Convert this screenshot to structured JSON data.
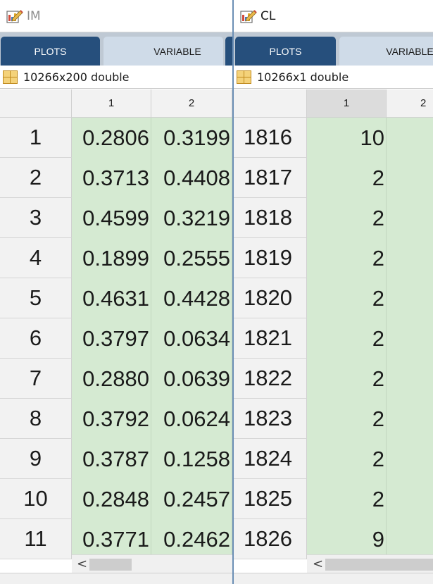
{
  "panes": [
    {
      "title": "IM",
      "icon": "variable-edit-icon",
      "tabs": [
        "PLOTS",
        "VARIABLE"
      ],
      "var_info": "10266x200 double",
      "columns": [
        "1",
        "2"
      ],
      "rows": [
        {
          "index": "1",
          "values": [
            "0.2806",
            "0.3199"
          ]
        },
        {
          "index": "2",
          "values": [
            "0.3713",
            "0.4408"
          ]
        },
        {
          "index": "3",
          "values": [
            "0.4599",
            "0.3219"
          ]
        },
        {
          "index": "4",
          "values": [
            "0.1899",
            "0.2555"
          ]
        },
        {
          "index": "5",
          "values": [
            "0.4631",
            "0.4428"
          ]
        },
        {
          "index": "6",
          "values": [
            "0.3797",
            "0.0634"
          ]
        },
        {
          "index": "7",
          "values": [
            "0.2880",
            "0.0639"
          ]
        },
        {
          "index": "8",
          "values": [
            "0.3792",
            "0.0624"
          ]
        },
        {
          "index": "9",
          "values": [
            "0.3787",
            "0.1258"
          ]
        },
        {
          "index": "10",
          "values": [
            "0.2848",
            "0.2457"
          ]
        },
        {
          "index": "11",
          "values": [
            "0.3771",
            "0.2462"
          ]
        }
      ],
      "scroll_left_arrow": "<"
    },
    {
      "title": "CL",
      "icon": "variable-edit-icon",
      "tabs": [
        "PLOTS",
        "VARIABLE"
      ],
      "var_info": "10266x1 double",
      "columns": [
        "1",
        "2"
      ],
      "selected_column": "1",
      "rows": [
        {
          "index": "1816",
          "values": [
            "10",
            ""
          ]
        },
        {
          "index": "1817",
          "values": [
            "2",
            ""
          ]
        },
        {
          "index": "1818",
          "values": [
            "2",
            ""
          ]
        },
        {
          "index": "1819",
          "values": [
            "2",
            ""
          ]
        },
        {
          "index": "1820",
          "values": [
            "2",
            ""
          ]
        },
        {
          "index": "1821",
          "values": [
            "2",
            ""
          ]
        },
        {
          "index": "1822",
          "values": [
            "2",
            ""
          ]
        },
        {
          "index": "1823",
          "values": [
            "2",
            ""
          ]
        },
        {
          "index": "1824",
          "values": [
            "2",
            ""
          ]
        },
        {
          "index": "1825",
          "values": [
            "2",
            ""
          ]
        },
        {
          "index": "1826",
          "values": [
            "9",
            ""
          ]
        }
      ],
      "scroll_left_arrow": "<"
    }
  ],
  "colors": {
    "cell_bg": "#d5ead2",
    "tab_active": "#264f7c",
    "tab_inactive": "#cfdbe8",
    "tabstrip_bg": "#bfc9d4",
    "header_bg": "#f2f2f2"
  }
}
